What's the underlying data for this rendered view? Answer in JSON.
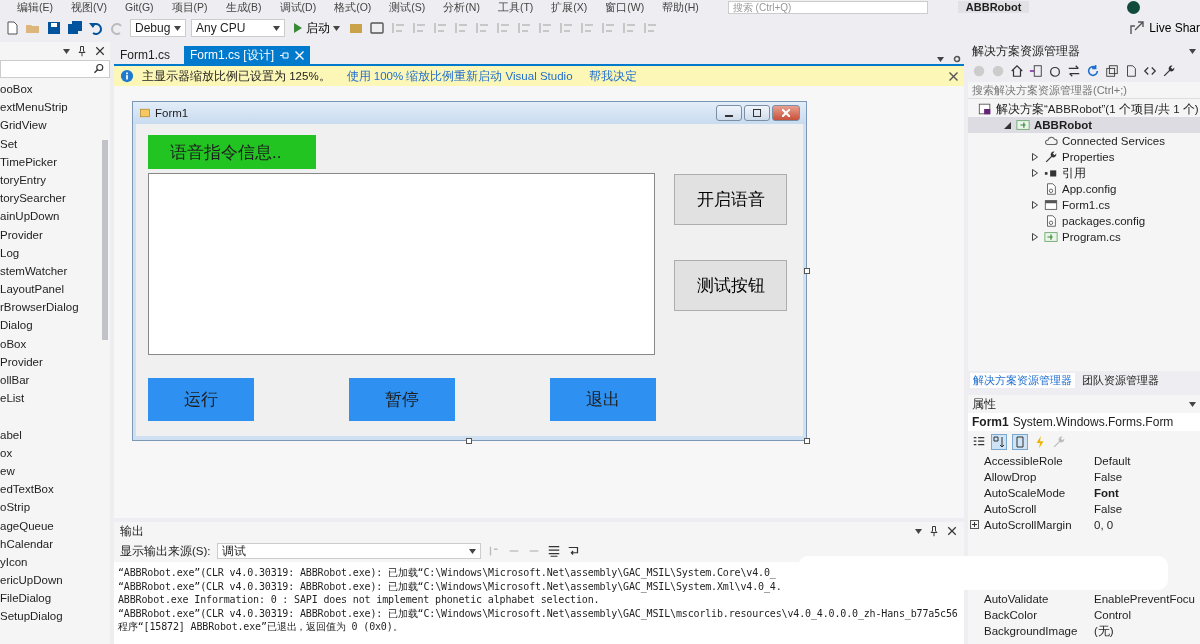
{
  "menu": [
    "编辑(E)",
    "视图(V)",
    "Git(G)",
    "项目(P)",
    "生成(B)",
    "调试(D)",
    "格式(O)",
    "测试(S)",
    "分析(N)",
    "工具(T)",
    "扩展(X)",
    "窗口(W)",
    "帮助(H)"
  ],
  "search": {
    "placeholder": "搜索 (Ctrl+Q)"
  },
  "app_title": "ABBRobot",
  "toolbar": {
    "configuration": "Debug",
    "platform": "Any CPU",
    "start": "启动",
    "live_share": "Live Shar"
  },
  "toolbox": {
    "items": [
      {
        "label": "ooBox",
        "group_start": false
      },
      {
        "label": "extMenuStrip",
        "group_start": false
      },
      {
        "label": "GridView",
        "group_start": false
      },
      {
        "label": "Set",
        "group_start": false
      },
      {
        "label": "TimePicker",
        "group_start": false
      },
      {
        "label": "toryEntry",
        "group_start": false
      },
      {
        "label": "torySearcher",
        "group_start": false
      },
      {
        "label": "ainUpDown",
        "group_start": false
      },
      {
        "label": "Provider",
        "group_start": false
      },
      {
        "label": "Log",
        "group_start": false
      },
      {
        "label": "stemWatcher",
        "group_start": false
      },
      {
        "label": "LayoutPanel",
        "group_start": false
      },
      {
        "label": "rBrowserDialog",
        "group_start": false
      },
      {
        "label": "Dialog",
        "group_start": false
      },
      {
        "label": "oBox",
        "group_start": false
      },
      {
        "label": "Provider",
        "group_start": false
      },
      {
        "label": "ollBar",
        "group_start": false
      },
      {
        "label": "eList",
        "group_start": false
      },
      {
        "label": "abel",
        "group_start": true
      },
      {
        "label": "ox",
        "group_start": false
      },
      {
        "label": "ew",
        "group_start": false
      },
      {
        "label": "edTextBox",
        "group_start": false
      },
      {
        "label": "oStrip",
        "group_start": false
      },
      {
        "label": "ageQueue",
        "group_start": false
      },
      {
        "label": "hCalendar",
        "group_start": false
      },
      {
        "label": "yIcon",
        "group_start": false
      },
      {
        "label": "ericUpDown",
        "group_start": false
      },
      {
        "label": "FileDialog",
        "group_start": false
      },
      {
        "label": "SetupDialog",
        "group_start": false
      }
    ]
  },
  "doc_tabs": [
    {
      "label": "Form1.cs",
      "selected": false
    },
    {
      "label": "Form1.cs [设计]",
      "selected": true
    }
  ],
  "info_bar": {
    "message": "主显示器缩放比例已设置为 125%。",
    "links": [
      "使用 100% 缩放比例重新启动 Visual Studio",
      "帮我决定"
    ]
  },
  "form": {
    "title": "Form1",
    "label": "语音指令信息..",
    "side_buttons": [
      "开启语音",
      "测试按钮"
    ],
    "bottom_buttons": [
      "运行",
      "暂停",
      "退出"
    ]
  },
  "output": {
    "title": "输出",
    "source_label": "显示输出来源(S):",
    "source": "调试",
    "lines": [
      "“ABBRobot.exe”(CLR v4.0.30319: ABBRobot.exe): 已加载“C:\\Windows\\Microsoft.Net\\assembly\\GAC_MSIL\\System.Core\\v4.0_",
      "“ABBRobot.exe”(CLR v4.0.30319: ABBRobot.exe): 已加载“C:\\Windows\\Microsoft.Net\\assembly\\GAC_MSIL\\System.Xml\\v4.0_4.",
      "ABBRobot.exe Information: 0 : SAPI does not implement phonetic alphabet selection.",
      "“ABBRobot.exe”(CLR v4.0.30319: ABBRobot.exe): 已加载“C:\\Windows\\Microsoft.Net\\assembly\\GAC_MSIL\\mscorlib.resources\\v4.0_4.0.0.0_zh-Hans_b77a5c56",
      "程序“[15872] ABBRobot.exe”已退出，返回值为 0 (0x0)。"
    ]
  },
  "solution_explorer": {
    "title": "解决方案资源管理器",
    "search_placeholder": "搜索解决方案资源管理器(Ctrl+;)",
    "tree": [
      {
        "label": "解决方案“ABBRobot”(1 个项目/共 1 个)",
        "kind": "solution",
        "selected": false,
        "children": [
          {
            "label": "ABBRobot",
            "kind": "project",
            "selected": true,
            "expanded": true,
            "children": [
              {
                "label": "Connected Services",
                "kind": "cloud",
                "selected": false
              },
              {
                "label": "Properties",
                "kind": "wrench",
                "selected": false,
                "expanded": false
              },
              {
                "label": "引用",
                "kind": "reference",
                "selected": false,
                "expanded": false
              },
              {
                "label": "App.config",
                "kind": "config",
                "selected": false
              },
              {
                "label": "Form1.cs",
                "kind": "form",
                "selected": false,
                "expanded": false
              },
              {
                "label": "packages.config",
                "kind": "config",
                "selected": false
              },
              {
                "label": "Program.cs",
                "kind": "csharp",
                "selected": false,
                "expanded": false
              }
            ]
          }
        ]
      }
    ],
    "tabs": [
      {
        "label": "解决方案资源管理器",
        "selected": true
      },
      {
        "label": "团队资源管理器",
        "selected": false
      }
    ]
  },
  "properties": {
    "title": "属性",
    "object": "Form1",
    "type": "System.Windows.Forms.Form",
    "rows": [
      {
        "name": "AccessibleRole",
        "value": "Default",
        "bold": false,
        "expandable": false
      },
      {
        "name": "AllowDrop",
        "value": "False",
        "bold": false,
        "expandable": false
      },
      {
        "name": "AutoScaleMode",
        "value": "Font",
        "bold": true,
        "expandable": false
      },
      {
        "name": "AutoScroll",
        "value": "False",
        "bold": false,
        "expandable": false
      },
      {
        "name": "AutoScrollMargin",
        "value": "0, 0",
        "bold": false,
        "expandable": true
      }
    ],
    "rows_below": [
      {
        "name": "AutoValidate",
        "value": "EnablePreventFocu",
        "bold": false,
        "expandable": false
      },
      {
        "name": "BackColor",
        "value": "Control",
        "bold": false,
        "expandable": false
      },
      {
        "name": "BackgroundImage",
        "value": "(无)",
        "bold": false,
        "expandable": false
      }
    ]
  }
}
